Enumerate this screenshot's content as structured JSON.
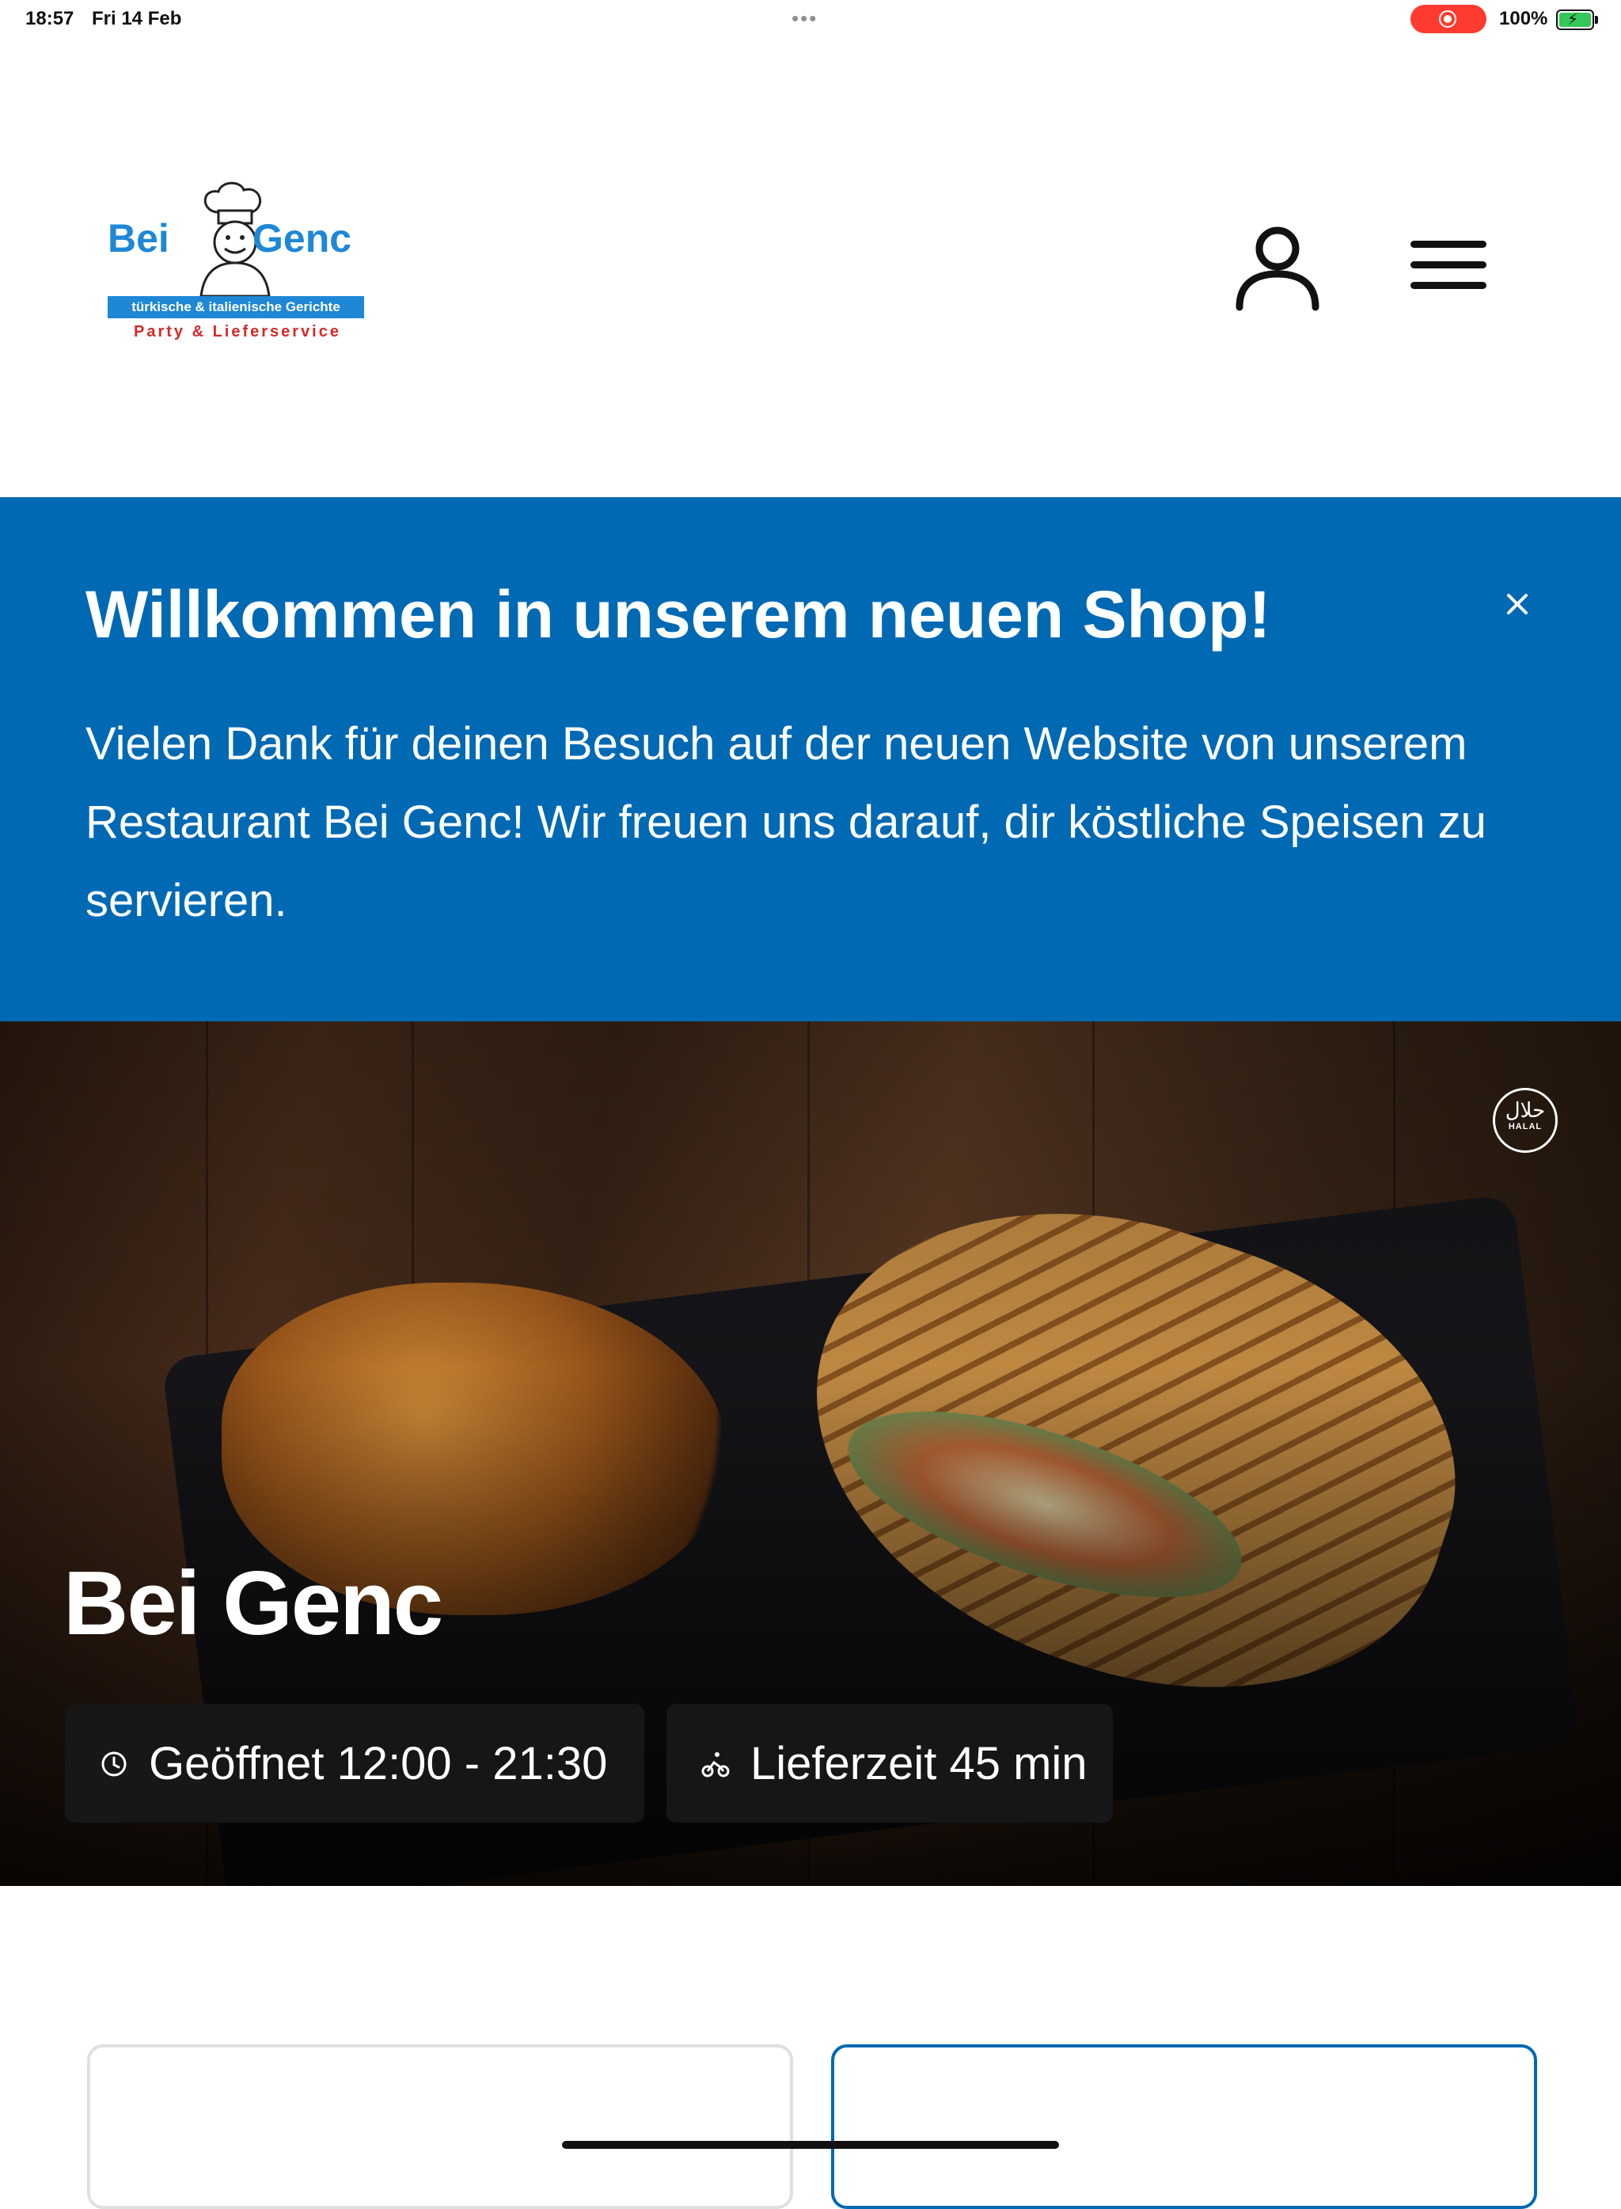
{
  "status_bar": {
    "time": "18:57",
    "date": "Fri 14 Feb",
    "battery": "100%"
  },
  "header": {
    "logo": {
      "brand_left": "Bei",
      "brand_right": "Genc",
      "subtitle": "türkische & italienische Gerichte",
      "tagline": "Party & Lieferservice"
    },
    "account_icon": "user-icon",
    "menu_icon": "hamburger-menu-icon"
  },
  "banner": {
    "title": "Willkommen in unserem neuen Shop!",
    "text": "Vielen Dank für deinen Besuch auf der neuen Website von unserem Restaurant Bei Genc! Wir freuen uns darauf, dir köstliche Speisen zu servieren.",
    "background": "#0069b4",
    "close_icon": "close-icon"
  },
  "hero": {
    "title": "Bei Genc",
    "halal_badge": {
      "arabic": "حلال",
      "latin": "HALAL"
    },
    "chips": {
      "opening": {
        "icon": "clock-icon",
        "label": "Geöffnet 12:00 - 21:30"
      },
      "delivery": {
        "icon": "bicycle-icon",
        "label": "Lieferzeit 45 min"
      }
    }
  },
  "colors": {
    "accent": "#0069b4",
    "logo_blue": "#1e88d6",
    "logo_red": "#d62828"
  }
}
